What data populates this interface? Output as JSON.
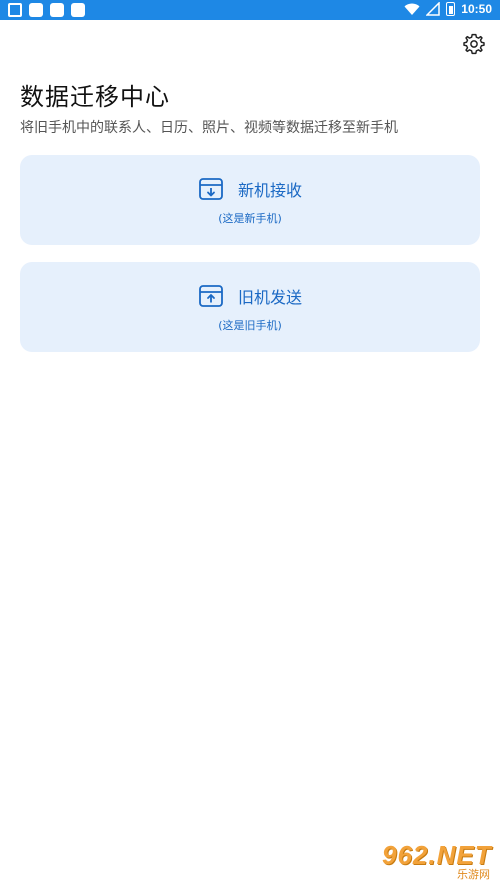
{
  "status_bar": {
    "time": "10:50",
    "icons": [
      "screen-icon",
      "notification-icon",
      "notification-icon",
      "notification-icon",
      "wifi-icon",
      "signal-icon",
      "battery-icon"
    ]
  },
  "header": {
    "title": "数据迁移中心",
    "subtitle": "将旧手机中的联系人、日历、照片、视频等数据迁移至新手机"
  },
  "options": {
    "receive": {
      "label": "新机接收",
      "hint": "(这是新手机)"
    },
    "send": {
      "label": "旧机发送",
      "hint": "(这是旧手机)"
    }
  },
  "watermark": {
    "brand": "962.NET",
    "sub": "乐游网"
  },
  "colors": {
    "status_bar": "#1e88e5",
    "card_bg": "#e6f0fc",
    "accent": "#1b69c4"
  }
}
